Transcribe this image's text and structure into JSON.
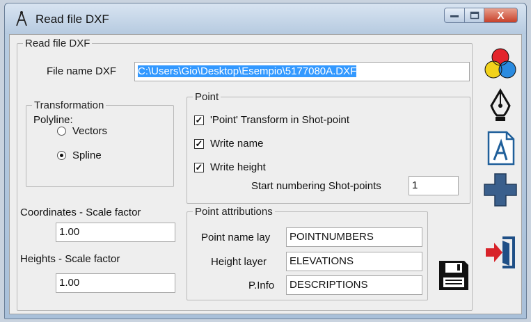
{
  "window": {
    "title": "Read file DXF"
  },
  "main": {
    "group_title": "Read file DXF",
    "file_name_label": "File name DXF",
    "file_name_value": "C:\\Users\\Gio\\Desktop\\Esempio\\5177080A.DXF"
  },
  "transformation": {
    "title": "Transformation",
    "polyline_label": "Polyline:",
    "option_vectors": "Vectors",
    "option_spline": "Spline",
    "selected": "Spline"
  },
  "point": {
    "title": "Point",
    "transform_label": "'Point' Transform in Shot-point",
    "transform_checked": true,
    "write_name_label": "Write name",
    "write_name_checked": true,
    "write_height_label": "Write height",
    "write_height_checked": true,
    "start_numbering_label": "Start numbering Shot-points",
    "start_numbering_value": "1"
  },
  "coordinates": {
    "label": "Coordinates - Scale factor",
    "value": "1.00"
  },
  "heights": {
    "label": "Heights - Scale factor",
    "value": "1.00"
  },
  "attributions": {
    "title": "Point attributions",
    "name_layer_label": "Point name lay",
    "name_layer_value": "POINTNUMBERS",
    "height_layer_label": "Height layer",
    "height_layer_value": "ELEVATIONS",
    "info_label": "P.Info",
    "info_value": "DESCRIPTIONS"
  },
  "caption_buttons": {
    "close_glyph": "X"
  },
  "toolbar": {
    "icons": [
      "color-circles-icon",
      "pen-nib-icon",
      "text-document-icon",
      "plus-cross-icon",
      "exit-door-icon"
    ]
  },
  "colors": {
    "selection": "#3399ff",
    "close_button": "#c7402a",
    "plus_icon": "#3a5f8c",
    "exit_arrow": "#d8232a"
  }
}
